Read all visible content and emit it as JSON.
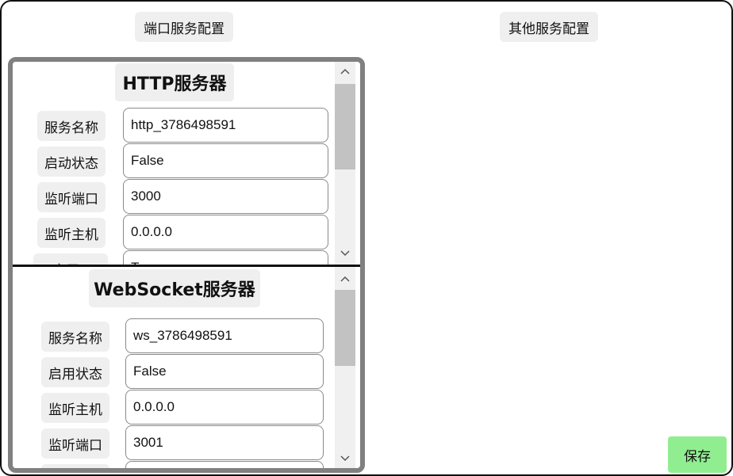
{
  "tabs": [
    {
      "label": "端口服务配置"
    },
    {
      "label": "其他服务配置"
    }
  ],
  "http_section": {
    "title": "HTTP服务器",
    "fields": [
      {
        "label": "服务名称",
        "value": "http_3786498591"
      },
      {
        "label": "启动状态",
        "value": "False"
      },
      {
        "label": "监听端口",
        "value": "3000"
      },
      {
        "label": "监听主机",
        "value": "0.0.0.0"
      },
      {
        "label": "启用C",
        "value": "T"
      }
    ]
  },
  "ws_section": {
    "title": "WebSocket服务器",
    "fields": [
      {
        "label": "服务名称",
        "value": "ws_3786498591"
      },
      {
        "label": "启用状态",
        "value": "False"
      },
      {
        "label": "监听主机",
        "value": "0.0.0.0"
      },
      {
        "label": "监听端口",
        "value": "3001"
      }
    ]
  },
  "save_button": {
    "label": "保存",
    "color": "#90ee90"
  },
  "icons": {
    "scroll_up": "chevron-up-icon",
    "scroll_down": "chevron-down-icon"
  }
}
